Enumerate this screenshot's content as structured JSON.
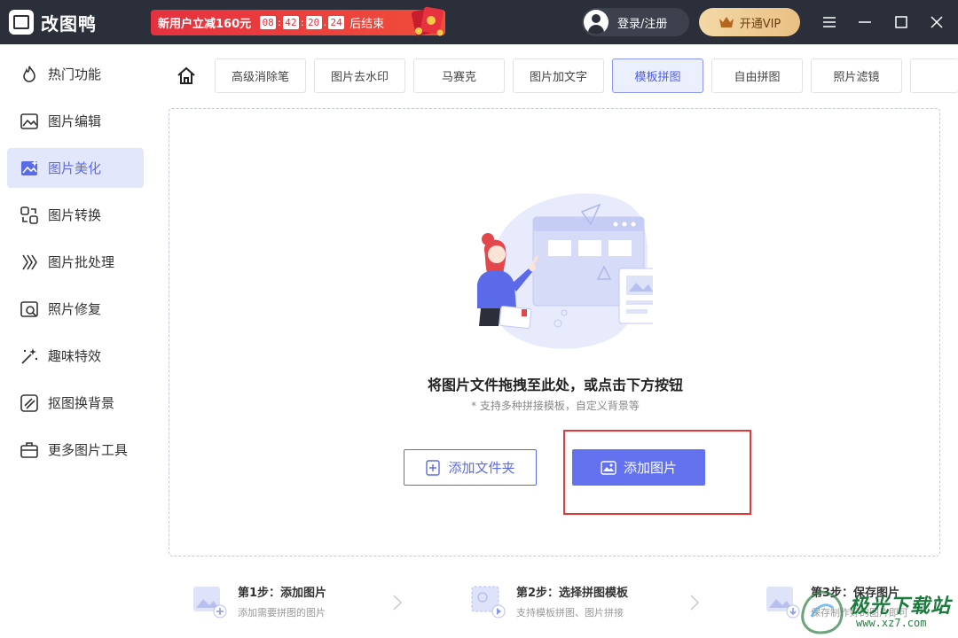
{
  "app": {
    "title": "改图鸭"
  },
  "promo": {
    "text": "新用户立减160元",
    "timer": [
      "08",
      "42",
      "20",
      "24"
    ],
    "end_text": "后结束"
  },
  "login": {
    "label": "登录/注册"
  },
  "vip": {
    "label": "开通VIP"
  },
  "sidebar": {
    "items": [
      {
        "label": "热门功能",
        "icon": "fire-icon"
      },
      {
        "label": "图片编辑",
        "icon": "image-edit-icon"
      },
      {
        "label": "图片美化",
        "icon": "image-beautify-icon",
        "active": true
      },
      {
        "label": "图片转换",
        "icon": "convert-icon"
      },
      {
        "label": "图片批处理",
        "icon": "batch-icon"
      },
      {
        "label": "照片修复",
        "icon": "photo-repair-icon"
      },
      {
        "label": "趣味特效",
        "icon": "magic-wand-icon"
      },
      {
        "label": "抠图换背景",
        "icon": "cutout-icon"
      },
      {
        "label": "更多图片工具",
        "icon": "toolbox-icon"
      }
    ]
  },
  "tabs": [
    {
      "label": "高级消除笔"
    },
    {
      "label": "图片去水印"
    },
    {
      "label": "马赛克"
    },
    {
      "label": "图片加文字"
    },
    {
      "label": "模板拼图",
      "active": true
    },
    {
      "label": "自由拼图"
    },
    {
      "label": "照片滤镜"
    }
  ],
  "dropzone": {
    "title": "将图片文件拖拽至此处，或点击下方按钮",
    "subtitle": "* 支持多种拼接模板，自定义背景等"
  },
  "buttons": {
    "add_folder": "添加文件夹",
    "add_image": "添加图片"
  },
  "steps": [
    {
      "title": "第1步：添加图片",
      "desc": "添加需要拼图的图片"
    },
    {
      "title": "第2步：选择拼图模板",
      "desc": "支持模板拼图、图片拼接"
    },
    {
      "title": "第3步：保存图片",
      "desc": "保存制作好的图片即可"
    }
  ],
  "watermark": {
    "text": "极光下载站",
    "url": "www.xz7.com"
  },
  "colors": {
    "accent": "#6272ee",
    "titlebar": "#2b2f3a",
    "promo": "#e5313f",
    "highlight": "#e23a3a"
  }
}
